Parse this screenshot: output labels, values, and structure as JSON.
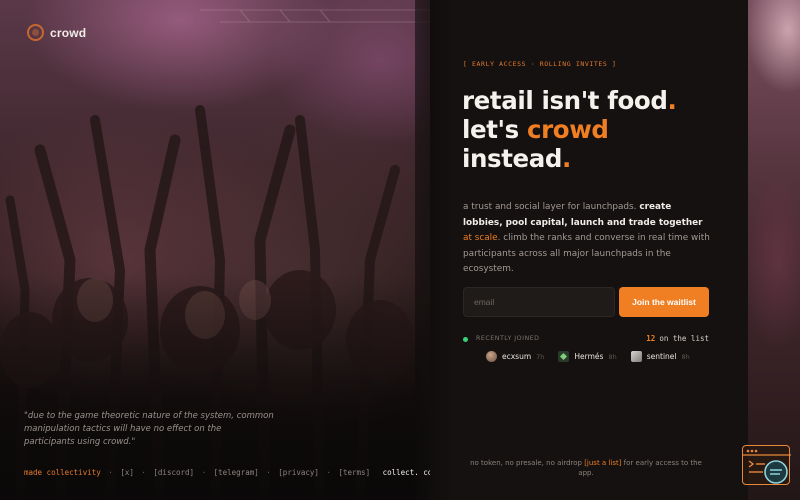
{
  "brand": {
    "name": "crowd"
  },
  "hero": {
    "eyebrow": "[ EARLY ACCESS · ROLLING INVITES ]",
    "headline_line1": "retail isn't food",
    "headline_line2_pre": "let's ",
    "headline_line2_accent": "crowd",
    "headline_line3": "instead",
    "period": ".",
    "desc_lead": "a trust and social layer for launchpads. ",
    "desc_bold": "create lobbies, pool capital, launch and trade together ",
    "desc_highlight": "at scale",
    "desc_tail": ". climb the ranks and converse in real time with participants across all major launchpads in the ecosystem."
  },
  "waitlist": {
    "email_placeholder": "email",
    "button_label": "Join the waitlist"
  },
  "recent": {
    "label": "RECENTLY JOINED",
    "count": "12",
    "count_suffix": "on the list",
    "users": [
      {
        "name": "ecxsum",
        "time": "7h"
      },
      {
        "name": "Hermés",
        "time": "8h"
      },
      {
        "name": "sentinel",
        "time": "8h"
      }
    ]
  },
  "quote": "\"due to the game theoretic nature of the system, common manipulation tactics will have no effect on the participants using crowd.\"",
  "footer": {
    "made": "made collectivity",
    "links": [
      "[x]",
      "[discord]",
      "[telegram]",
      "[privacy]",
      "[terms]"
    ],
    "ticker": "collect. conce"
  },
  "bottom_note": {
    "pre": "no token, no presale, no airdrop ",
    "link": "[just a list]",
    "post": " for early access to the app."
  },
  "colors": {
    "accent": "#f07e22",
    "background": "#141110",
    "online": "#36d27a"
  }
}
